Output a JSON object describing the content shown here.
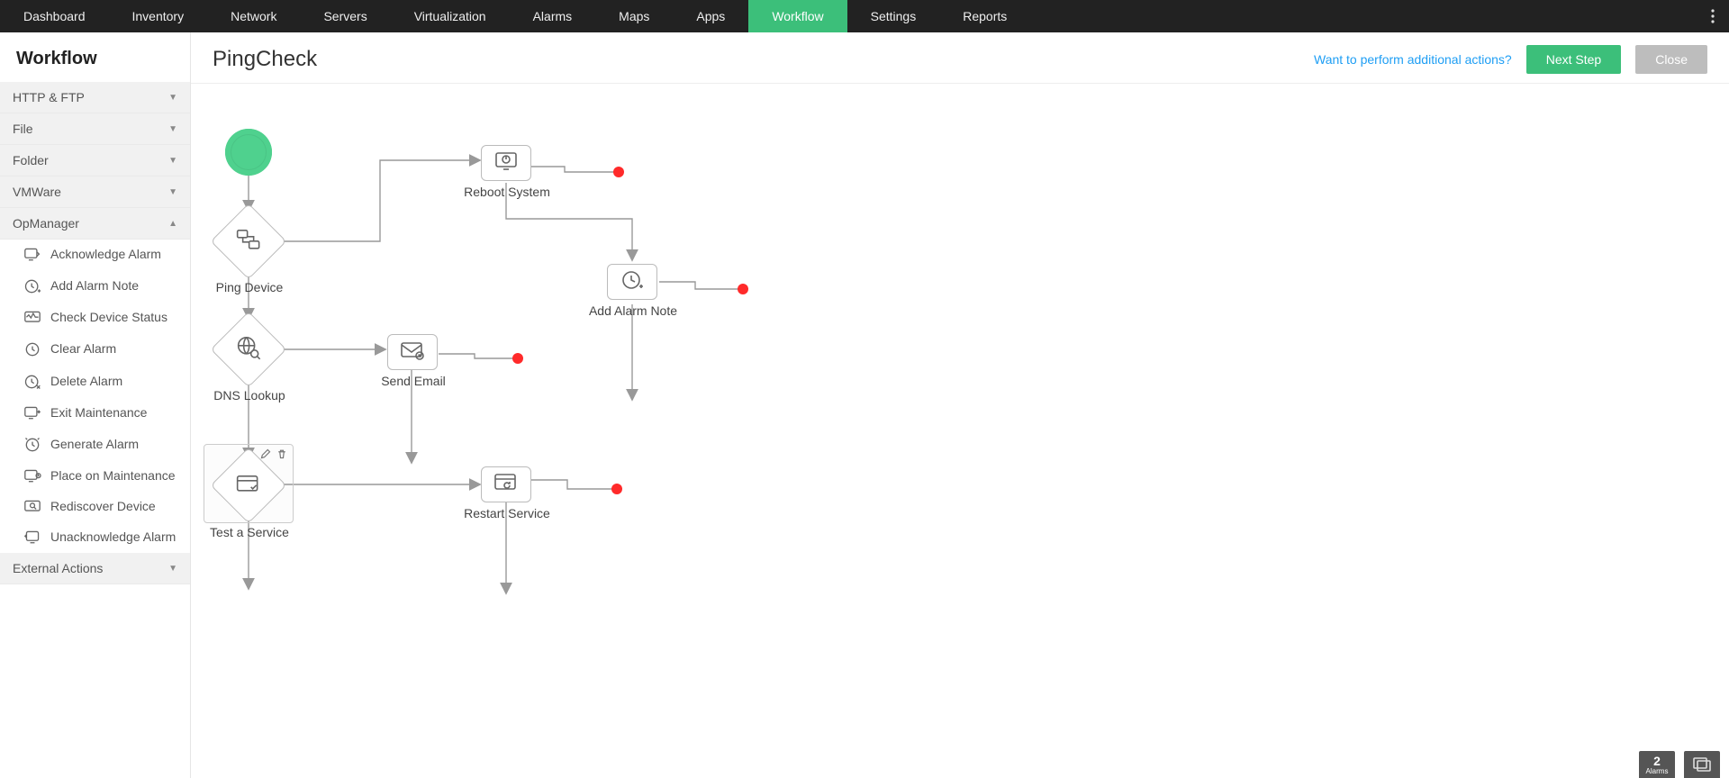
{
  "topnav": {
    "items": [
      "Dashboard",
      "Inventory",
      "Network",
      "Servers",
      "Virtualization",
      "Alarms",
      "Maps",
      "Apps",
      "Workflow",
      "Settings",
      "Reports"
    ],
    "active": "Workflow"
  },
  "sidebar": {
    "title": "Workflow",
    "groups": [
      {
        "label": "HTTP & FTP",
        "open": false
      },
      {
        "label": "File",
        "open": false
      },
      {
        "label": "Folder",
        "open": false
      },
      {
        "label": "VMWare",
        "open": false
      },
      {
        "label": "OpManager",
        "open": true,
        "items": [
          "Acknowledge Alarm",
          "Add Alarm Note",
          "Check Device Status",
          "Clear Alarm",
          "Delete Alarm",
          "Exit Maintenance",
          "Generate Alarm",
          "Place on Maintenance",
          "Rediscover Device",
          "Unacknowledge Alarm"
        ]
      },
      {
        "label": "External Actions",
        "open": false
      }
    ]
  },
  "main": {
    "title": "PingCheck",
    "hintlink": "Want to perform additional actions?",
    "btn_next": "Next Step",
    "btn_close": "Close"
  },
  "nodes": {
    "ping_device": {
      "label": "Ping Device"
    },
    "dns_lookup": {
      "label": "DNS Lookup"
    },
    "test_service": {
      "label": "Test a Service"
    },
    "reboot_system": {
      "label": "Reboot System"
    },
    "send_email": {
      "label": "Send Email"
    },
    "restart_svc": {
      "label": "Restart Service"
    },
    "add_note": {
      "label": "Add Alarm Note"
    }
  },
  "floater": {
    "count": "2",
    "count_label": "Alarms"
  }
}
